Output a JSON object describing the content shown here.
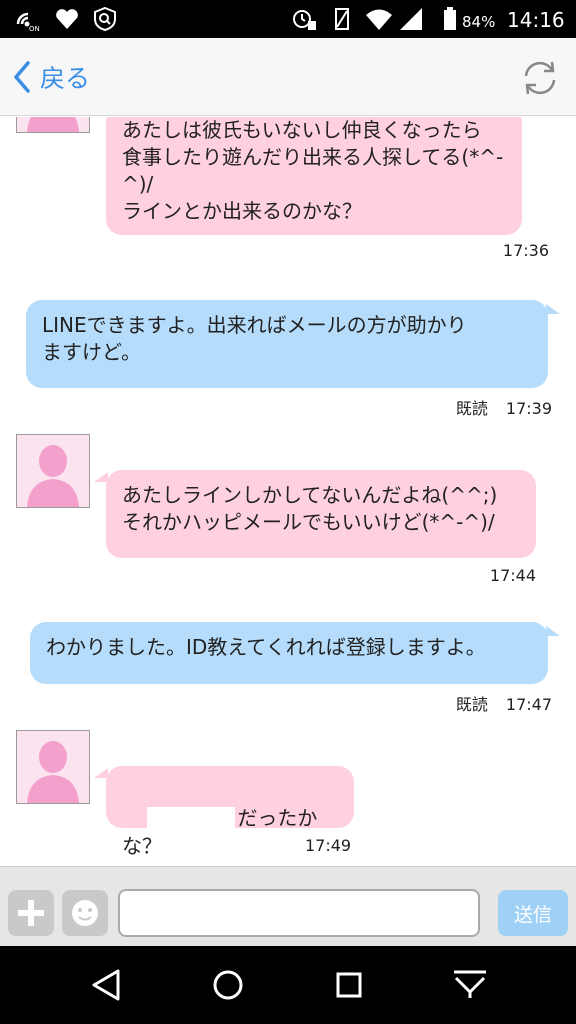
{
  "status_bar": {
    "battery_percent": "84%",
    "time": "14:16"
  },
  "nav": {
    "back_label": "戻る",
    "refresh_icon": "refresh-icon"
  },
  "messages": [
    {
      "side": "in",
      "text": "あたしは彼氏もいないし仲良くなったら\n食事したり遊んだり出来る人探してる(*^-\n^)/\nラインとか出来るのかな？",
      "time": "17:36"
    },
    {
      "side": "out",
      "text": "LINEできますよ。出来ればメールの方が助かり\nますけど。",
      "read": "既読",
      "time": "17:39"
    },
    {
      "side": "in",
      "text": "あたしラインしかしてないんだよね(^^;)\nそれかハッピメールでもいいけど(*^-^)/",
      "time": "17:44"
    },
    {
      "side": "out",
      "text": "わかりました。ID教えてくれれば登録しますよ。",
      "read": "既読",
      "time": "17:47"
    },
    {
      "side": "in",
      "text": "だったかな？",
      "time": "17:49"
    }
  ],
  "input_bar": {
    "plus_icon": "plus-icon",
    "emoji_icon": "smiley-icon",
    "message_placeholder": "",
    "send_label": "送信"
  },
  "colors": {
    "incoming_bubble": "#ffd0de",
    "outgoing_bubble": "#b6dcfb",
    "accent": "#3a8ee6"
  }
}
